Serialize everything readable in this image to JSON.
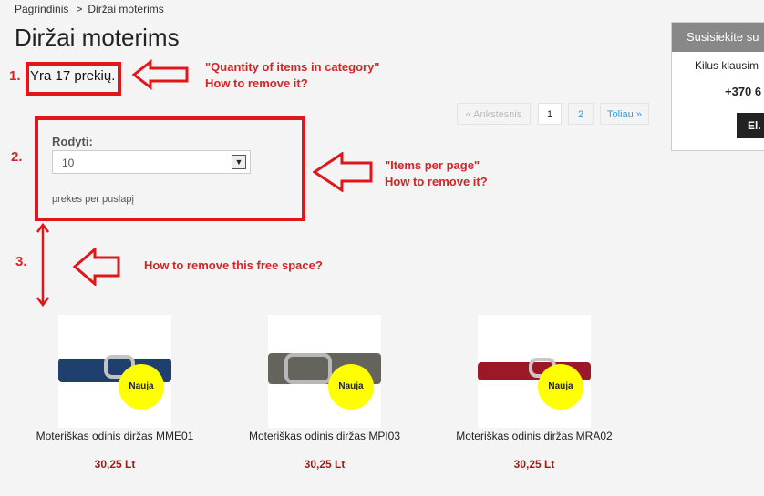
{
  "breadcrumb": {
    "home": "Pagrindinis",
    "separator": ">",
    "current": "Diržai moterims"
  },
  "page_title": "Diržai moterims",
  "category_count": "Yra 17 prekių.",
  "pagination": {
    "prev": "« Ankstesnis",
    "page1": "1",
    "page2": "2",
    "next": "Toliau »"
  },
  "per_page": {
    "label": "Rodyti:",
    "value": "10",
    "note": "prekes per puslapį"
  },
  "contact": {
    "header": "Susisiekite su",
    "question": "Kilus klausim",
    "phone": "+370 6",
    "button": "El. p"
  },
  "annotations": {
    "n1": "1.",
    "n2": "2.",
    "n3": "3.",
    "t1_line1": "\"Quantity of items in category\"",
    "t1_line2": "How to remove it?",
    "t2_line1": "\"Items per page\"",
    "t2_line2": "How to remove it?",
    "t3": "How to remove this free space?"
  },
  "products": [
    {
      "name": "Moteriškas odinis diržas MME01",
      "price": "30,25 Lt",
      "badge": "Nauja",
      "belt_color": "#1f3f6e"
    },
    {
      "name": "Moteriškas odinis diržas MPI03",
      "price": "30,25 Lt",
      "badge": "Nauja",
      "belt_color": "#65645c"
    },
    {
      "name": "Moteriškas odinis diržas MRA02",
      "price": "30,25 Lt",
      "badge": "Nauja",
      "belt_color": "#9c1827"
    }
  ],
  "colors": {
    "annotation_red": "#e0161b",
    "price": "#9b1b1b",
    "link": "#2d9ed8"
  }
}
